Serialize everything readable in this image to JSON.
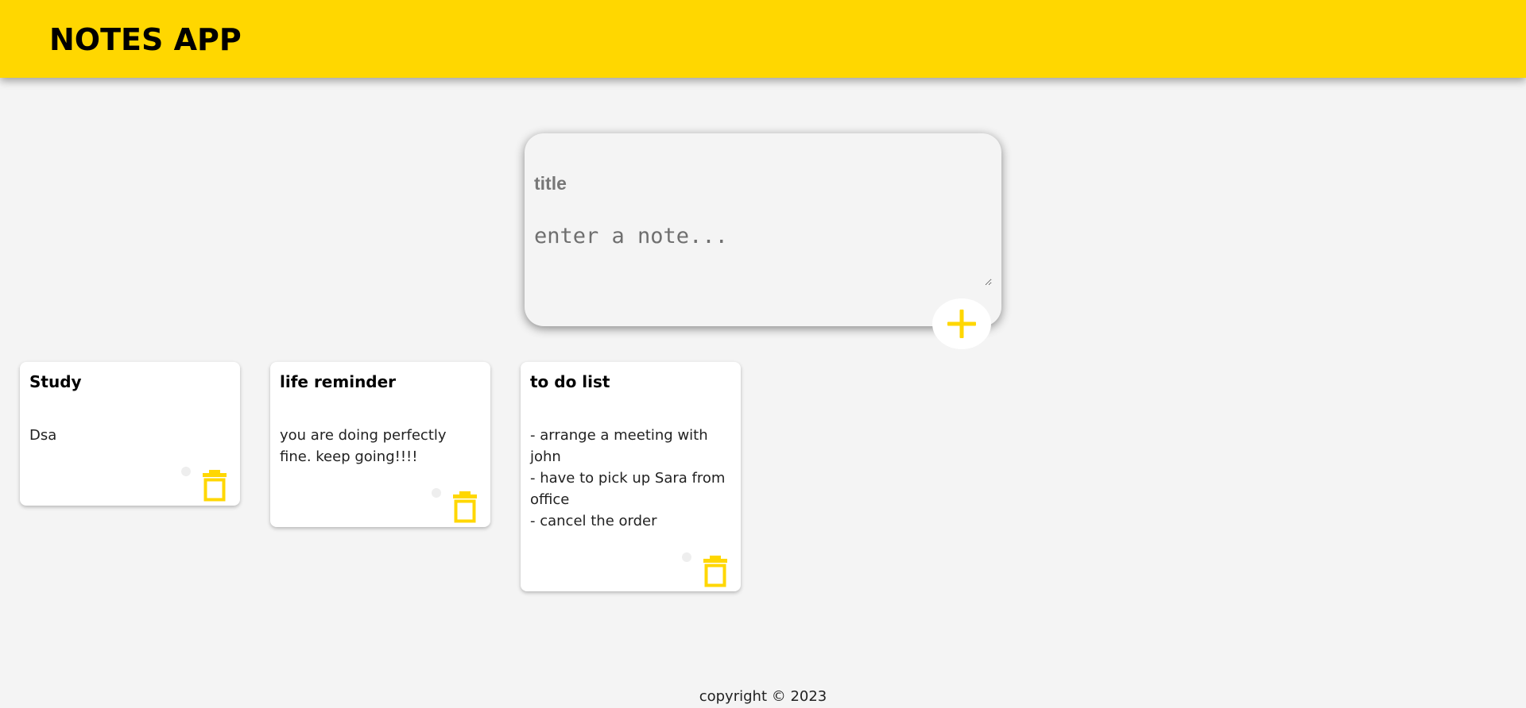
{
  "header": {
    "title": "NOTES APP",
    "background_color": "#ffd700"
  },
  "create_area": {
    "title_placeholder": "title",
    "note_placeholder": "enter a note...",
    "add_icon": "plus-icon",
    "accent_color": "#ffd700"
  },
  "notes": [
    {
      "title": "Study",
      "content": "Dsa",
      "delete_icon": "trash-icon"
    },
    {
      "title": "life reminder",
      "content": "you are doing perfectly fine. keep going!!!!",
      "delete_icon": "trash-icon"
    },
    {
      "title": "to do list",
      "content": "- arrange a meeting with john\n- have to pick up Sara from office\n- cancel the order",
      "delete_icon": "trash-icon"
    }
  ],
  "footer": {
    "text": "copyright © 2023"
  }
}
